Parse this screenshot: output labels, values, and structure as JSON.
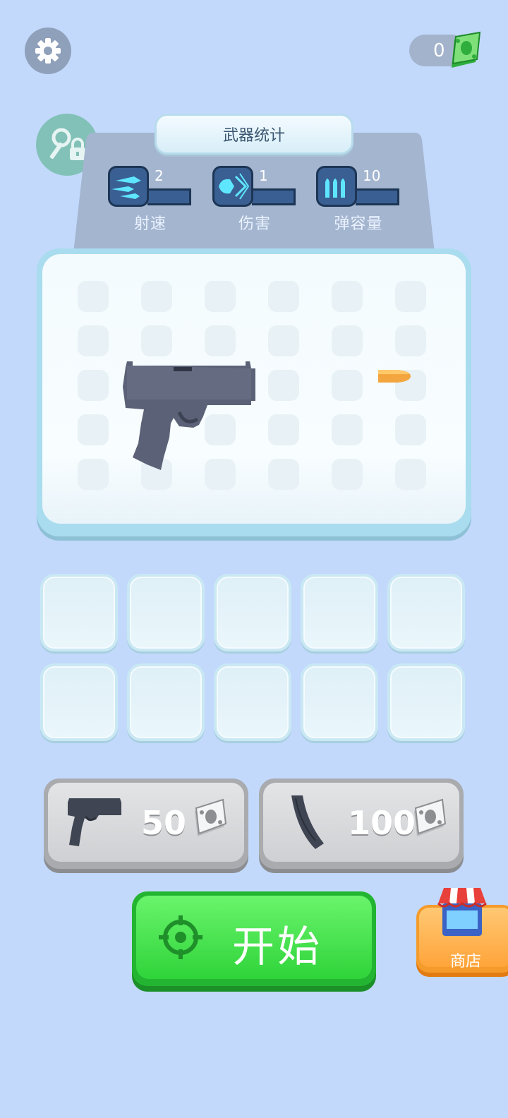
{
  "header": {
    "cash_amount": "0"
  },
  "stats": {
    "title": "武器统计",
    "items": [
      {
        "label": "射速",
        "value": "2",
        "icon": "fire-rate-icon"
      },
      {
        "label": "伤害",
        "value": "1",
        "icon": "damage-icon"
      },
      {
        "label": "弹容量",
        "value": "10",
        "icon": "ammo-capacity-icon"
      }
    ]
  },
  "shop_items": [
    {
      "icon": "pistol-icon",
      "price": "50"
    },
    {
      "icon": "magazine-icon",
      "price": "100"
    }
  ],
  "start_button": {
    "label": "开始",
    "icon": "crosshair-icon"
  },
  "shop_button": {
    "label": "商店",
    "icon": "shop-icon"
  },
  "colors": {
    "background": "#c2d9fc",
    "start_green": "#2fd43a",
    "shop_orange": "#ffa43a",
    "stat_blue": "#3a5f92"
  }
}
